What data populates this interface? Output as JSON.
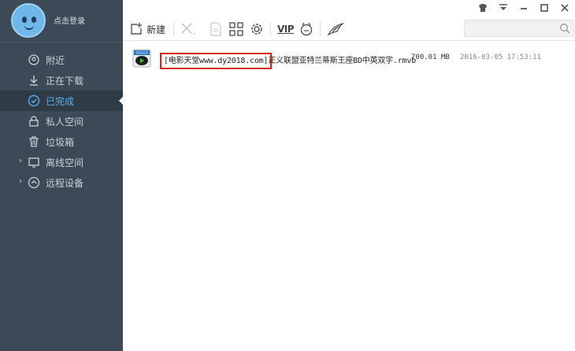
{
  "user": {
    "login_text": "点击登录"
  },
  "nav": {
    "items": [
      {
        "label": "附近",
        "icon": "location-icon",
        "active": false,
        "expandable": false
      },
      {
        "label": "正在下载",
        "icon": "download-icon",
        "active": false,
        "expandable": false
      },
      {
        "label": "已完成",
        "icon": "check-circle-icon",
        "active": true,
        "expandable": false
      },
      {
        "label": "私人空间",
        "icon": "lock-icon",
        "active": false,
        "expandable": false
      },
      {
        "label": "垃圾箱",
        "icon": "trash-icon",
        "active": false,
        "expandable": false
      },
      {
        "label": "离线空间",
        "icon": "cloud-screen-icon",
        "active": false,
        "expandable": true
      },
      {
        "label": "远程设备",
        "icon": "remote-device-icon",
        "active": false,
        "expandable": true
      }
    ]
  },
  "toolbar": {
    "new_label": "新建",
    "vip_label": "VIP",
    "search_placeholder": ""
  },
  "files": [
    {
      "highlight": "[电影天堂www.dy2018.com]",
      "rest": "正义联盟亚特兰蒂斯王座BD中英双字.rmvb",
      "size": "700.01 MB",
      "date": "2016-03-05 17:53:11"
    }
  ],
  "colors": {
    "sidebar_bg": "#3c4a57",
    "active_bg": "#2f3b46",
    "accent": "#5aaef0",
    "highlight_border": "#d9261c"
  }
}
